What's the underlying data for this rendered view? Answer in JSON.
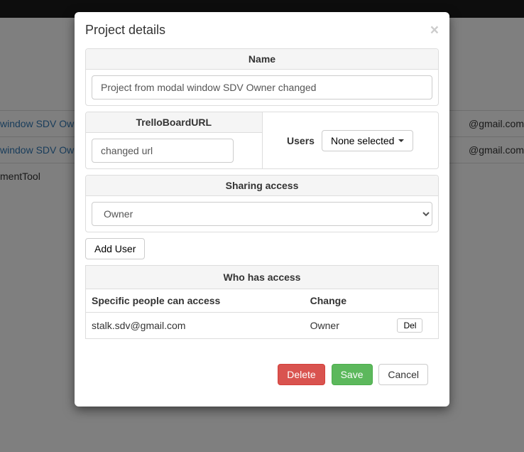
{
  "background": {
    "rows": [
      {
        "link": "window SDV Owner M",
        "email": "@gmail.com"
      },
      {
        "link": "window SDV Owner ch",
        "email": "@gmail.com"
      }
    ],
    "tool": "mentTool"
  },
  "modal": {
    "title": "Project details",
    "name_section": {
      "label": "Name",
      "value": "Project from modal window SDV Owner changed"
    },
    "trello_section": {
      "label": "TrelloBoardURL",
      "value": "changed url"
    },
    "users_section": {
      "label": "Users",
      "selected": "None selected"
    },
    "sharing_section": {
      "label": "Sharing access",
      "value": "Owner"
    },
    "add_user_label": "Add User",
    "access_section": {
      "title": "Who has access",
      "col1": "Specific people can access",
      "col2": "Change",
      "rows": [
        {
          "email": "stalk.sdv@gmail.com",
          "role": "Owner",
          "del": "Del"
        }
      ]
    },
    "footer": {
      "delete": "Delete",
      "save": "Save",
      "cancel": "Cancel"
    }
  }
}
